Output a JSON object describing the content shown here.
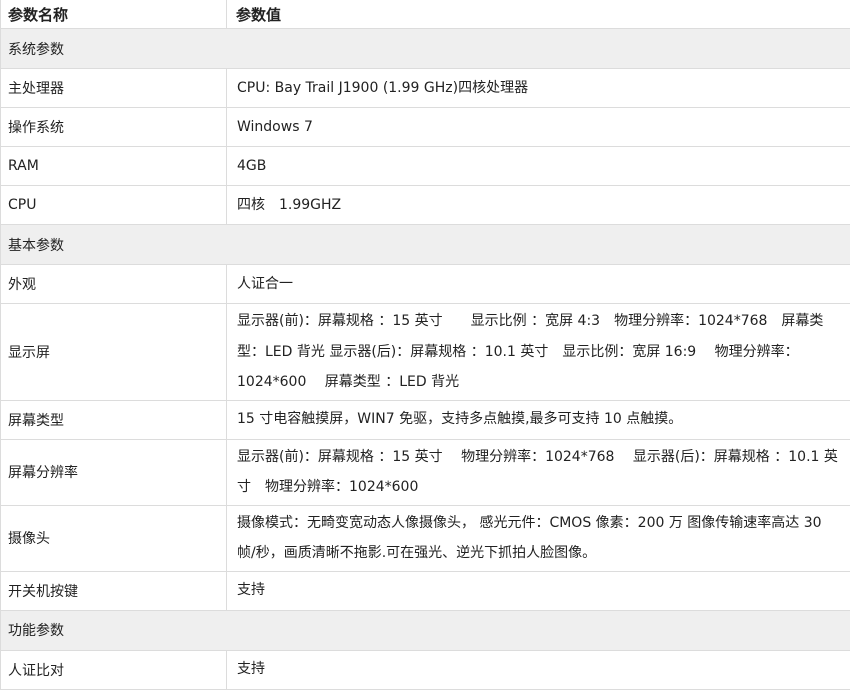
{
  "header": {
    "name": "参数名称",
    "value": "参数值"
  },
  "sections": [
    {
      "title": "系统参数",
      "rows": [
        {
          "name": "主处理器",
          "value": "CPU: Bay Trail J1900 (1.99 GHz)四核处理器"
        },
        {
          "name": "操作系统",
          "value": "Windows 7"
        },
        {
          "name": "RAM",
          "value": "4GB"
        },
        {
          "name": "CPU",
          "value": "四核　1.99GHZ"
        }
      ]
    },
    {
      "title": "基本参数",
      "rows": [
        {
          "name": "外观",
          "value": "人证合一"
        },
        {
          "name": "显示屏",
          "value": "显示器(前)：屏幕规格 ：15 英寸　　显示比例 ：宽屏 4:3　物理分辨率：1024*768　屏幕类型：LED 背光 显示器(后)：屏幕规格 ：10.1 英寸　显示比例：宽屏 16:9　 物理分辨率：1024*600　 屏幕类型 ：LED 背光"
        },
        {
          "name": "屏幕类型",
          "value": "15 寸电容触摸屏，WIN7 免驱，支持多点触摸,最多可支持 10 点触摸。"
        },
        {
          "name": "屏幕分辨率",
          "value": "显示器(前)：屏幕规格 ：15 英寸　 物理分辨率：1024*768　 显示器(后)：屏幕规格 ：10.1 英寸　物理分辨率：1024*600"
        },
        {
          "name": "摄像头",
          "value": "摄像模式：无畸变宽动态人像摄像头， 感光元件：CMOS 像素：200 万 图像传输速率高达 30 帧/秒，画质清晰不拖影.可在强光、逆光下抓拍人脸图像。"
        },
        {
          "name": "开关机按键",
          "value": "支持"
        }
      ]
    },
    {
      "title": "功能参数",
      "rows": [
        {
          "name": "人证比对",
          "value": "支持"
        }
      ]
    }
  ]
}
